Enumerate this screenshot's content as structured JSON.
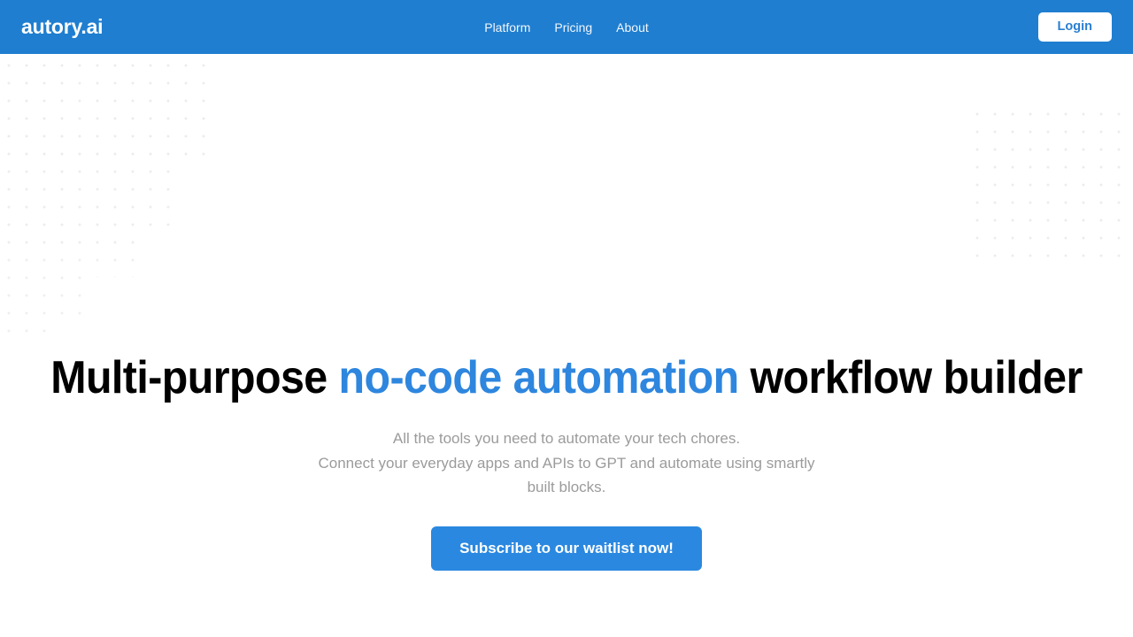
{
  "header": {
    "brand": "autory.ai",
    "nav": [
      {
        "label": "Platform"
      },
      {
        "label": "Pricing"
      },
      {
        "label": "About"
      }
    ],
    "login_label": "Login",
    "background_color": "#1f7ed0",
    "login_text_color": "#2a7fd0"
  },
  "hero": {
    "title_part1": "Multi-purpose ",
    "title_accent": "no-code automation",
    "title_part2": " workflow builder",
    "accent_color": "#2e86de",
    "subtitle_line1": "All the tools you need to automate your tech chores.",
    "subtitle_line2": "Connect your everyday apps and APIs to GPT and automate using smartly",
    "subtitle_line3": "built blocks.",
    "subtitle_color": "#9b9b9b",
    "cta_label": "Subscribe to our waitlist now!",
    "cta_color": "#2a88e0"
  },
  "decor": {
    "dot_color": "#ececec"
  }
}
